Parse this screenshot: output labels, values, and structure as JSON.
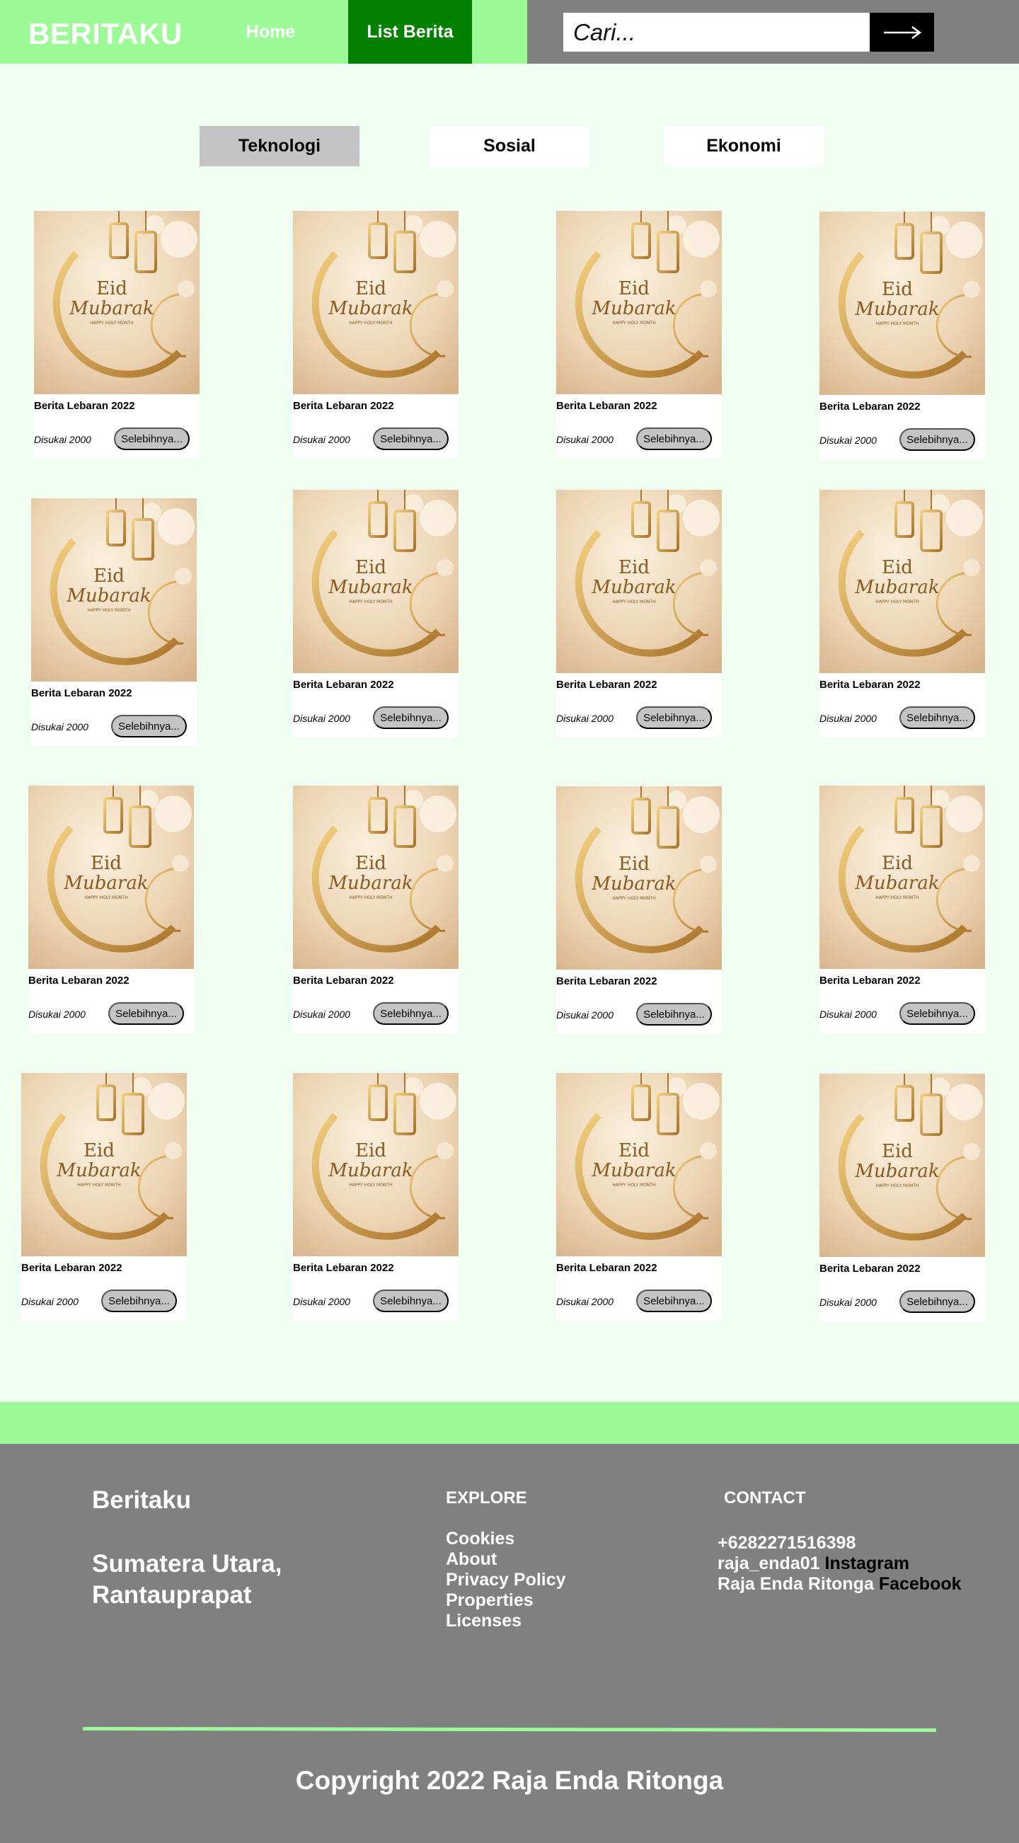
{
  "header": {
    "brand": "BERITAKU",
    "nav": [
      {
        "label": "Home"
      },
      {
        "label": "List Berita"
      }
    ],
    "search": {
      "placeholder": "Cari..."
    }
  },
  "tabs": [
    {
      "label": "Teknologi",
      "active": true
    },
    {
      "label": "Sosial",
      "active": false
    },
    {
      "label": "Ekonomi",
      "active": false
    }
  ],
  "cards": [
    {
      "title": "Berita Lebaran 2022",
      "likes": "Disukai 2000",
      "button": "Selebihnya..."
    },
    {
      "title": "Berita Lebaran 2022",
      "likes": "Disukai 2000",
      "button": "Selebihnya..."
    },
    {
      "title": "Berita Lebaran 2022",
      "likes": "Disukai 2000",
      "button": "Selebihnya..."
    },
    {
      "title": "Berita Lebaran 2022",
      "likes": "Disukai 2000",
      "button": "Selebihnya..."
    },
    {
      "title": "Berita Lebaran 2022",
      "likes": "Disukai 2000",
      "button": "Selebihnya..."
    },
    {
      "title": "Berita Lebaran 2022",
      "likes": "Disukai 2000",
      "button": "Selebihnya..."
    },
    {
      "title": "Berita Lebaran 2022",
      "likes": "Disukai 2000",
      "button": "Selebihnya..."
    },
    {
      "title": "Berita Lebaran 2022",
      "likes": "Disukai 2000",
      "button": "Selebihnya..."
    },
    {
      "title": "Berita Lebaran 2022",
      "likes": "Disukai 2000",
      "button": "Selebihnya..."
    },
    {
      "title": "Berita Lebaran 2022",
      "likes": "Disukai 2000",
      "button": "Selebihnya..."
    },
    {
      "title": "Berita Lebaran 2022",
      "likes": "Disukai 2000",
      "button": "Selebihnya..."
    },
    {
      "title": "Berita Lebaran 2022",
      "likes": "Disukai 2000",
      "button": "Selebihnya..."
    },
    {
      "title": "Berita Lebaran 2022",
      "likes": "Disukai 2000",
      "button": "Selebihnya..."
    },
    {
      "title": "Berita Lebaran 2022",
      "likes": "Disukai 2000",
      "button": "Selebihnya..."
    },
    {
      "title": "Berita Lebaran 2022",
      "likes": "Disukai 2000",
      "button": "Selebihnya..."
    },
    {
      "title": "Berita Lebaran 2022",
      "likes": "Disukai 2000",
      "button": "Selebihnya..."
    }
  ],
  "card_image": {
    "heading": "Eid",
    "script": "Mubarak",
    "tagline": "HAPPY HOLY MONTH"
  },
  "footer": {
    "brand": "Beritaku",
    "address": "Sumatera Utara, Rantauprapat",
    "explore_heading": "EXPLORE",
    "explore_links": [
      "Cookies",
      "About",
      "Privacy Policy",
      "Properties",
      "Licenses"
    ],
    "contact_heading": "CONTACT",
    "phone": "+6282271516398",
    "instagram_handle": "raja_enda01",
    "instagram_label": "Instagram",
    "facebook_handle": "Raja Enda Ritonga",
    "facebook_label": "Facebook",
    "copyright": "Copyright 2022 Raja Enda Ritonga"
  },
  "colors": {
    "page_bg": "#effef0",
    "accent_green": "#9cfb96",
    "nav_active": "#028000",
    "gray": "#808080",
    "tab_active": "#c4c4c4"
  },
  "icons": {
    "search_button": "arrow-right-icon"
  }
}
